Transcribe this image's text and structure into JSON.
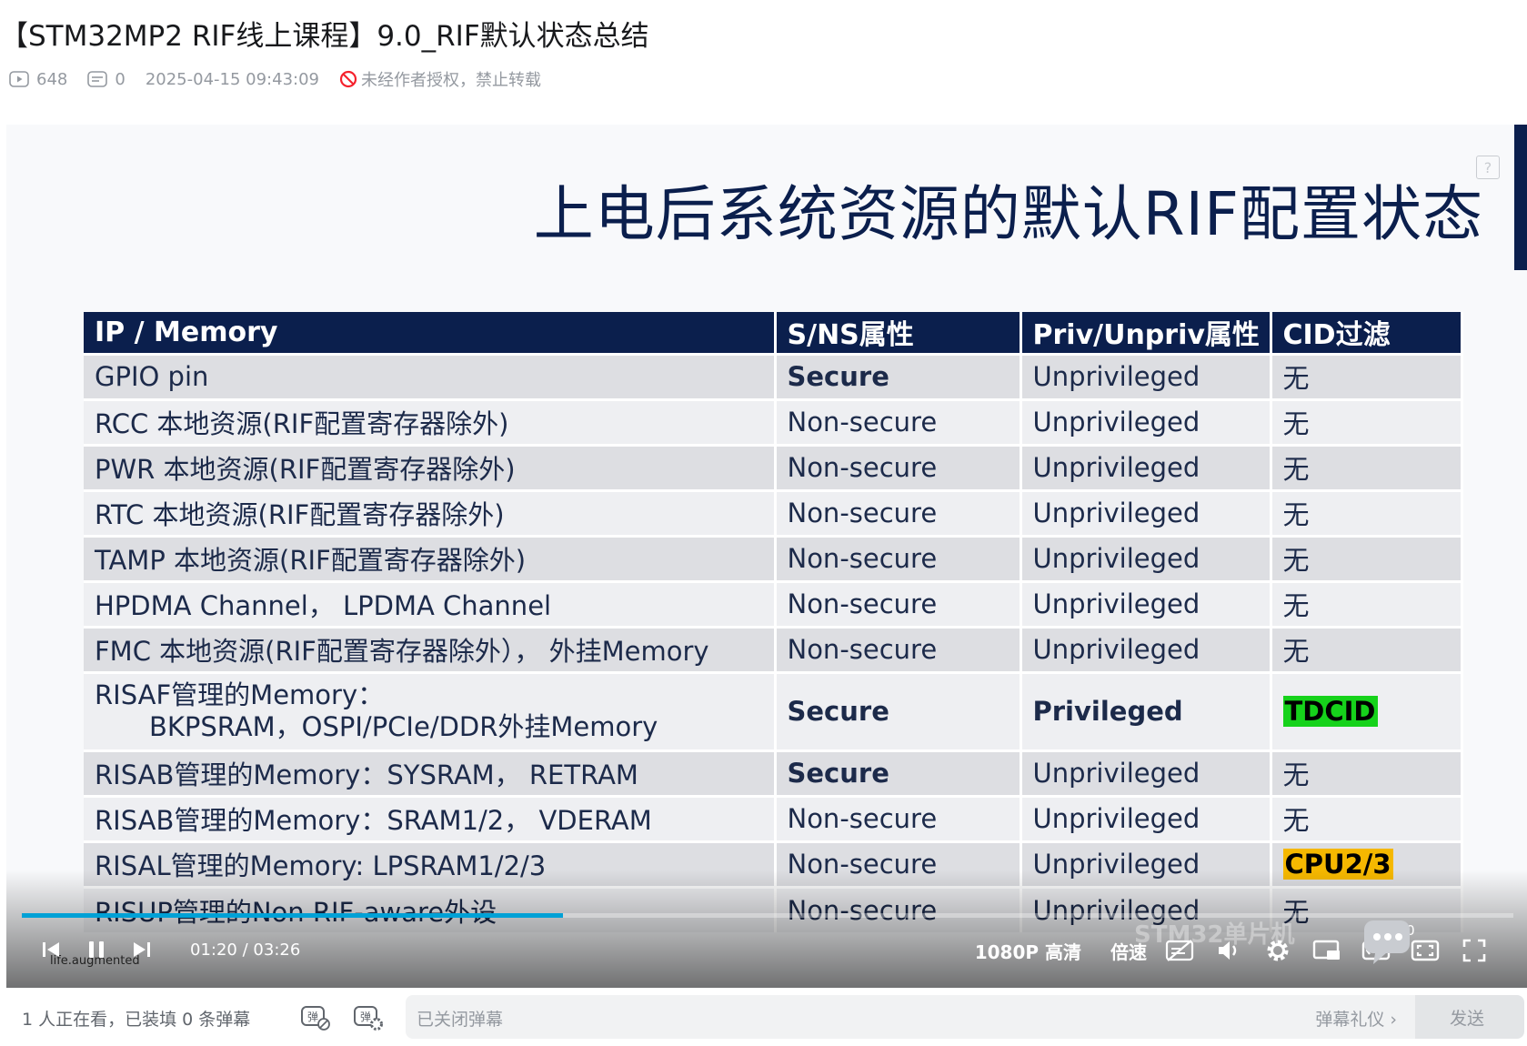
{
  "header": {
    "title": "【STM32MP2 RIF线上课程】9.0_RIF默认状态总结",
    "views": "648",
    "comments": "0",
    "datetime": "2025-04-15 09:43:09",
    "copyright": "未经作者授权，禁止转载"
  },
  "slide": {
    "title": "上电后系统资源的默认RIF配置状态",
    "columns": [
      "IP / Memory",
      "S/NS属性",
      "Priv/Unpriv属性",
      "CID过滤"
    ],
    "rows": [
      {
        "ip": "GPIO pin",
        "ip2": "",
        "sns": "Secure",
        "priv": "Unprivileged",
        "cid": "无"
      },
      {
        "ip": "RCC 本地资源(RIF配置寄存器除外)",
        "ip2": "",
        "sns": "Non-secure",
        "priv": "Unprivileged",
        "cid": "无"
      },
      {
        "ip": "PWR 本地资源(RIF配置寄存器除外)",
        "ip2": "",
        "sns": "Non-secure",
        "priv": "Unprivileged",
        "cid": "无"
      },
      {
        "ip": "RTC 本地资源(RIF配置寄存器除外)",
        "ip2": "",
        "sns": "Non-secure",
        "priv": "Unprivileged",
        "cid": "无"
      },
      {
        "ip": "TAMP 本地资源(RIF配置寄存器除外)",
        "ip2": "",
        "sns": "Non-secure",
        "priv": "Unprivileged",
        "cid": "无"
      },
      {
        "ip": "HPDMA Channel， LPDMA Channel",
        "ip2": "",
        "sns": "Non-secure",
        "priv": "Unprivileged",
        "cid": "无"
      },
      {
        "ip": "FMC 本地资源(RIF配置寄存器除外）， 外挂Memory",
        "ip2": "",
        "sns": "Non-secure",
        "priv": "Unprivileged",
        "cid": "无"
      },
      {
        "ip": "RISAF管理的Memory：",
        "ip2": "BKPSRAM，OSPI/PCIe/DDR外挂Memory",
        "sns": "Secure",
        "priv": "Privileged",
        "cid": "TDCID"
      },
      {
        "ip": "RISAB管理的Memory：SYSRAM， RETRAM",
        "ip2": "",
        "sns": "Secure",
        "priv": "Unprivileged",
        "cid": "无"
      },
      {
        "ip": "RISAB管理的Memory：SRAM1/2， VDERAM",
        "ip2": "",
        "sns": "Non-secure",
        "priv": "Unprivileged",
        "cid": "无"
      },
      {
        "ip": "RISAL管理的Memory: LPSRAM1/2/3",
        "ip2": "",
        "sns": "Non-secure",
        "priv": "Unprivileged",
        "cid": "CPU2/3"
      },
      {
        "ip": "RISUP管理的Non RIF-aware外设",
        "ip2": "",
        "sns": "Non-secure",
        "priv": "Unprivileged",
        "cid": "无"
      }
    ]
  },
  "player": {
    "current_time": "01:20",
    "separator": "/",
    "total_time": "03:26",
    "progress_fraction": 0.363,
    "quality": "1080P 高清",
    "speed": "倍速",
    "volume_level": "100",
    "logo_text": "life.augmented",
    "watermark": "STM32单片机"
  },
  "danmaku": {
    "status": "1 人正在看，已装填 0 条弹幕",
    "placeholder": "已关闭弹幕",
    "etiquette": "弹幕礼仪 ›",
    "send": "发送"
  },
  "colors": {
    "accent": "#00a1d6",
    "slide_navy": "#0b1f4d",
    "secure_green": "#00572d",
    "nonsecure_red": "#c0001f",
    "unpriv_purple": "#8b1c8f",
    "priv_blue": "#0099e6"
  }
}
